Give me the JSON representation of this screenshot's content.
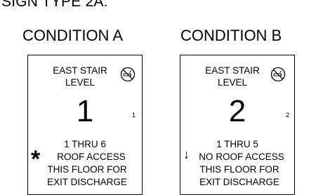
{
  "title": "SIGN TYPE 2A:",
  "conditions": [
    {
      "label": "CONDITION A",
      "sign": {
        "line1": "EAST STAIR",
        "line2": "LEVEL",
        "level_number": "1",
        "small_number": "1",
        "floors": "1 THRU 6",
        "roof_access": "ROOF ACCESS",
        "this_floor": "THIS FLOOR FOR",
        "exit_discharge": "EXIT DISCHARGE",
        "marker": "*",
        "marker_icon": "asterisk-icon"
      }
    },
    {
      "label": "CONDITION B",
      "sign": {
        "line1": "EAST STAIR",
        "line2": "LEVEL",
        "level_number": "2",
        "small_number": "2",
        "floors": "1 THRU 5",
        "roof_access": "NO ROOF ACCESS",
        "this_floor": "THIS FLOOR FOR",
        "exit_discharge": "EXIT DISCHARGE",
        "marker": "↓",
        "marker_icon": "down-arrow-icon"
      }
    }
  ],
  "icons": {
    "no_smoking": "no-smoking-icon"
  }
}
